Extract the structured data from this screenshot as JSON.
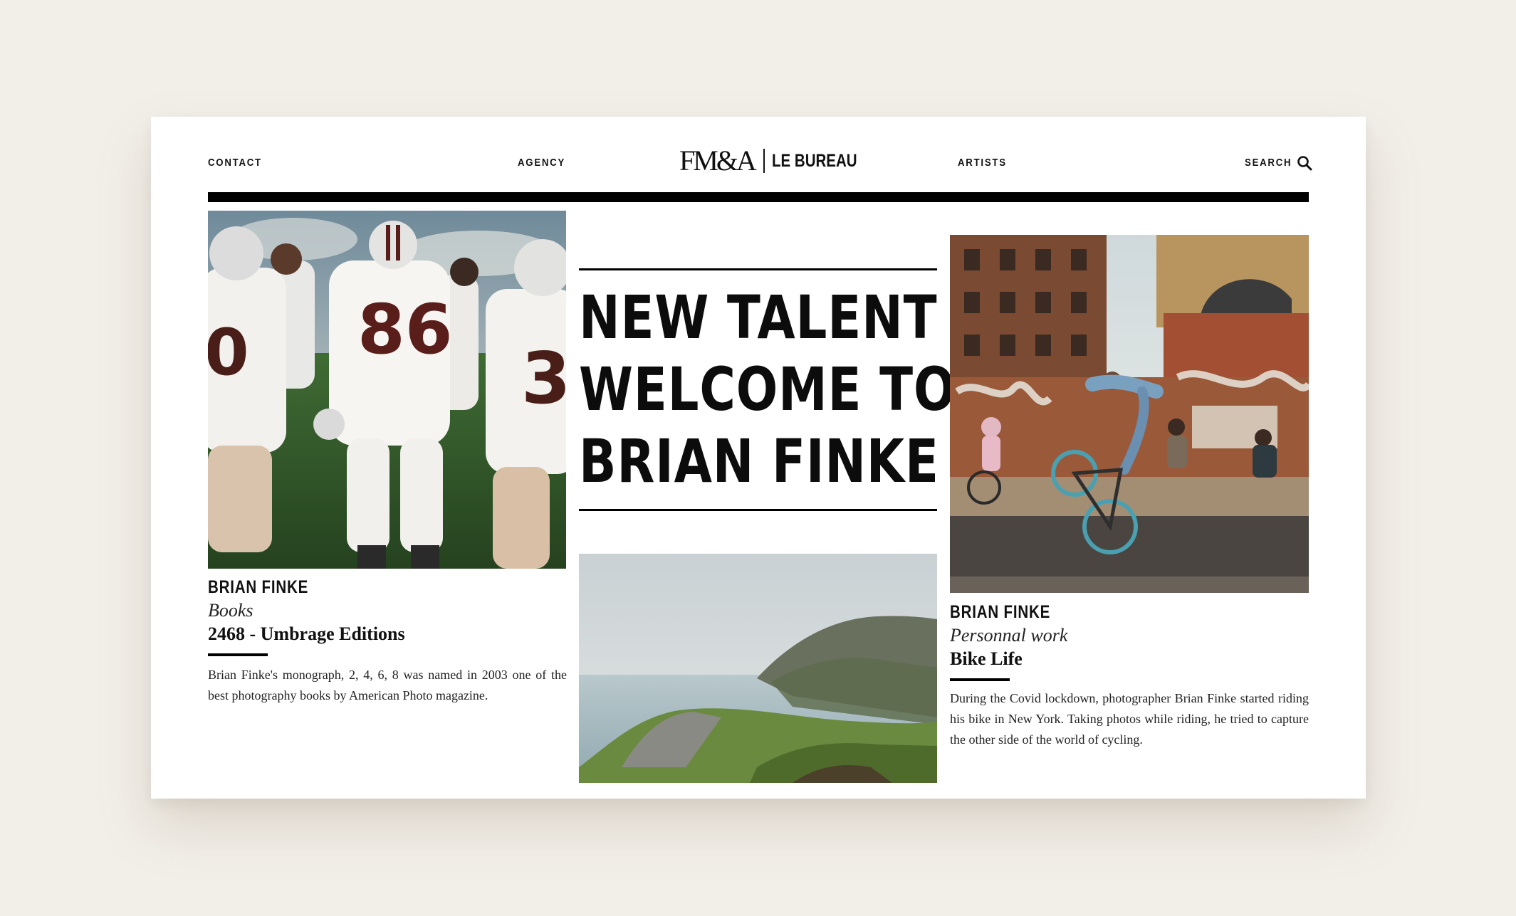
{
  "nav": {
    "contact": "CONTACT",
    "agency": "AGENCY",
    "artists": "ARTISTS",
    "search": "SEARCH",
    "search_icon": "search-icon"
  },
  "logo": {
    "mark": "FM&A",
    "text": "LE BUREAU"
  },
  "hero": {
    "line1": "NEW TALENT !",
    "line2": "WELCOME TO",
    "line3": "BRIAN FINKE"
  },
  "cards": {
    "left": {
      "artist": "BRIAN FINKE",
      "category": "Books",
      "title": "2468 - Umbrage Editions",
      "description": "Brian Finke's monograph, 2, 4, 6, 8 was named in 2003 one of the best photography books by American Photo magazine."
    },
    "right": {
      "artist": "BRIAN FINKE",
      "category": "Personnal work",
      "title": "Bike Life",
      "description": "During the Covid lockdown, photographer Brian Finke started riding his bike in New York. Taking photos while riding, he tried to capture the other side of the world of cycling."
    }
  },
  "colors": {
    "page_background": "#f2efe9",
    "card_background": "#ffffff",
    "text": "#111111",
    "rule": "#000000"
  }
}
